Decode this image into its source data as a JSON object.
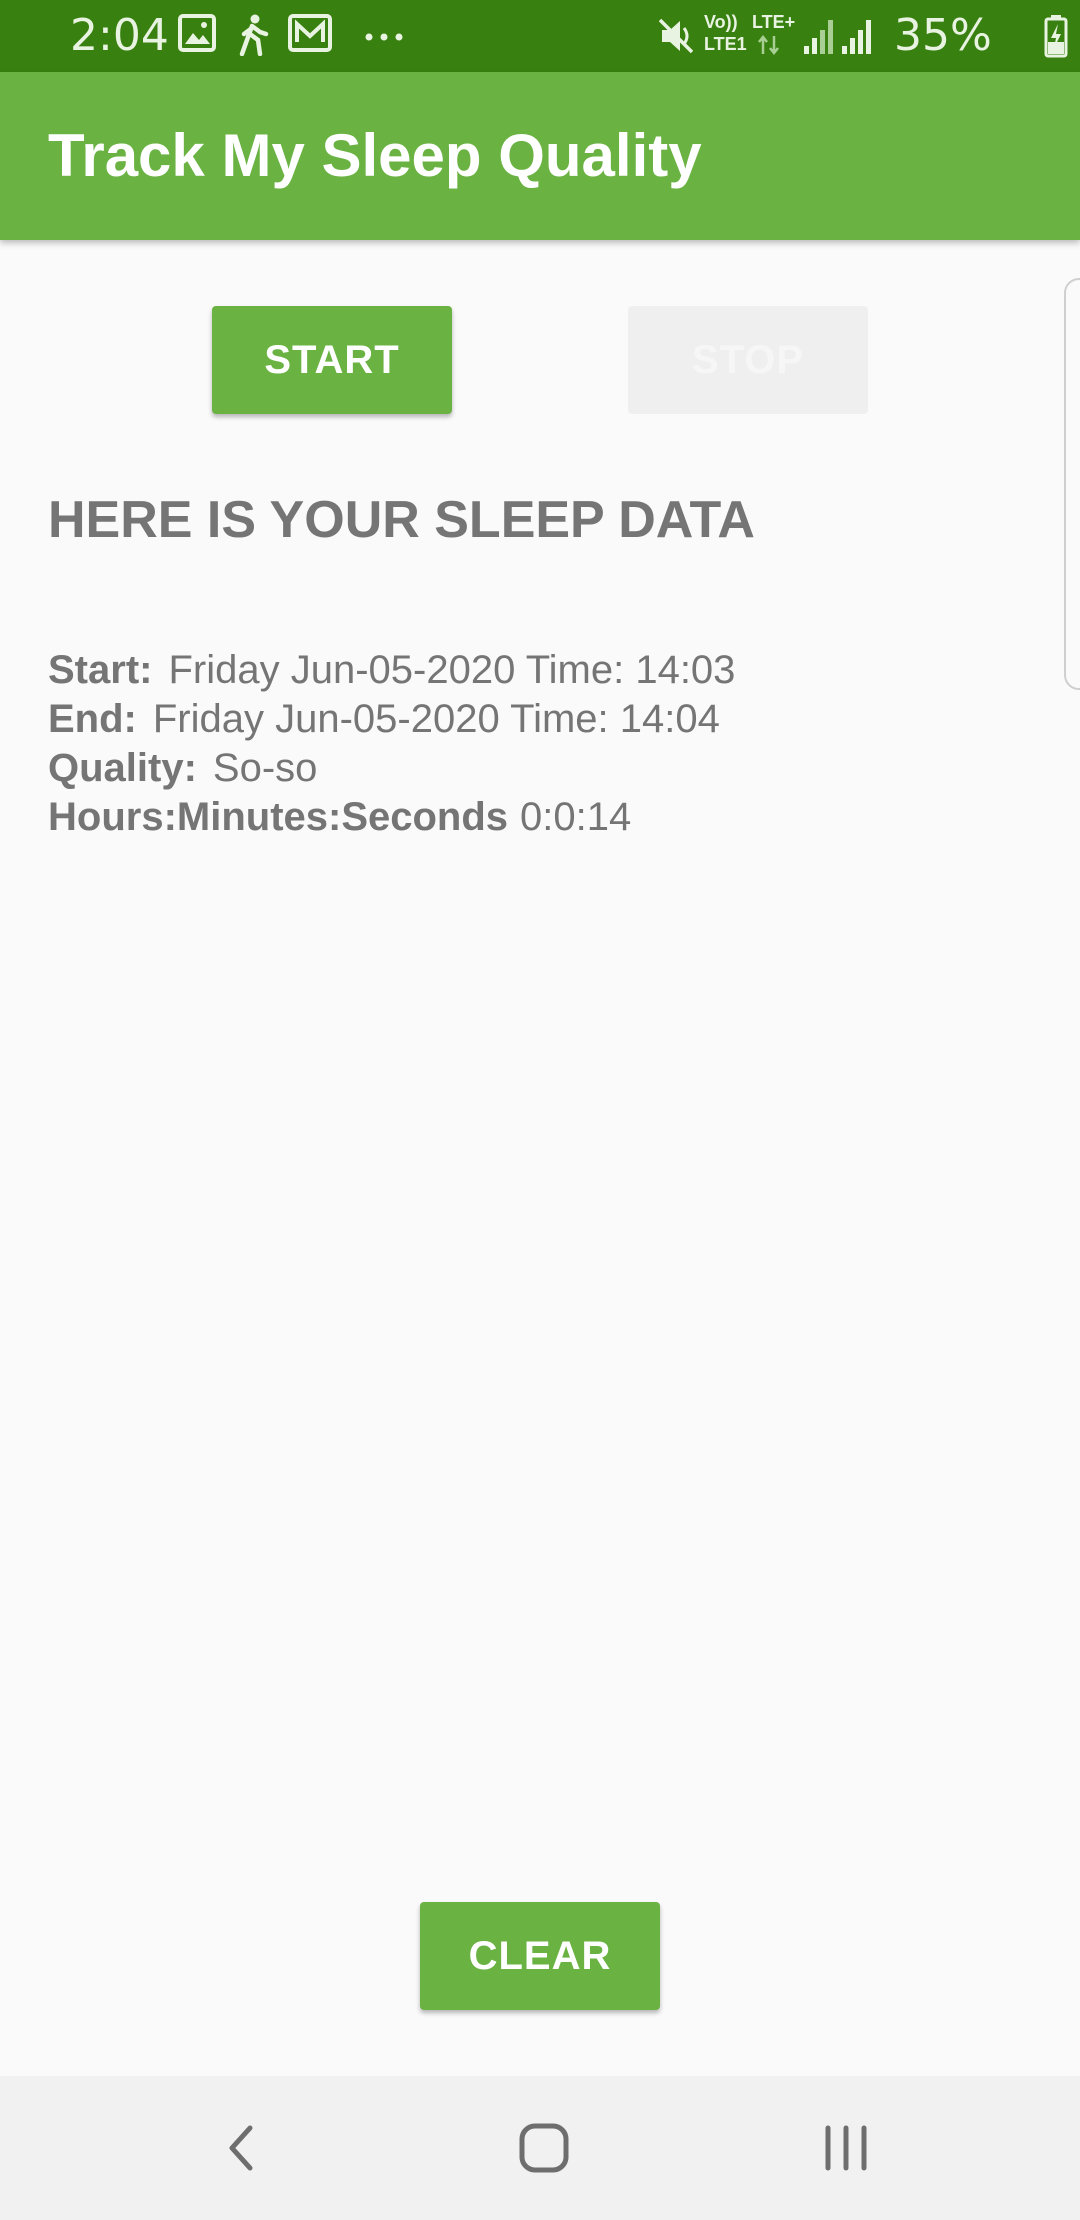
{
  "status_bar": {
    "time": "2:04",
    "battery": "35%",
    "icons_left": [
      "image-icon",
      "walking-icon",
      "mail-icon",
      "more-icon"
    ],
    "icons_right": [
      "mute-icon",
      "volte-icon",
      "lte-signal-icon",
      "signal-icon",
      "signal-icon",
      "battery-charging-icon"
    ],
    "volte_label": "Vo))",
    "lte1_label": "LTE1",
    "lte_plus_label": "LTE+"
  },
  "app_bar": {
    "title": "Track My Sleep Quality"
  },
  "buttons": {
    "start_label": "START",
    "stop_label": "STOP",
    "clear_label": "CLEAR"
  },
  "heading": "HERE IS YOUR SLEEP DATA",
  "sleep_data": [
    {
      "key": "Start:",
      "value": "Friday Jun-05-2020 Time: 14:03"
    },
    {
      "key": "End:",
      "value": "Friday Jun-05-2020 Time: 14:04"
    },
    {
      "key": "Quality:",
      "value": "So-so"
    },
    {
      "key": "Hours:Minutes:Seconds",
      "value": "0:0:14"
    }
  ],
  "colors": {
    "status_bar": "#38800f",
    "app_bar": "#6ab343",
    "button": "#6ab343",
    "text_secondary": "#757575",
    "background": "#fafafa",
    "nav_bar": "#f1f1f1"
  },
  "nav_bar": {
    "icons": [
      "back-icon",
      "home-icon",
      "recents-icon"
    ]
  }
}
